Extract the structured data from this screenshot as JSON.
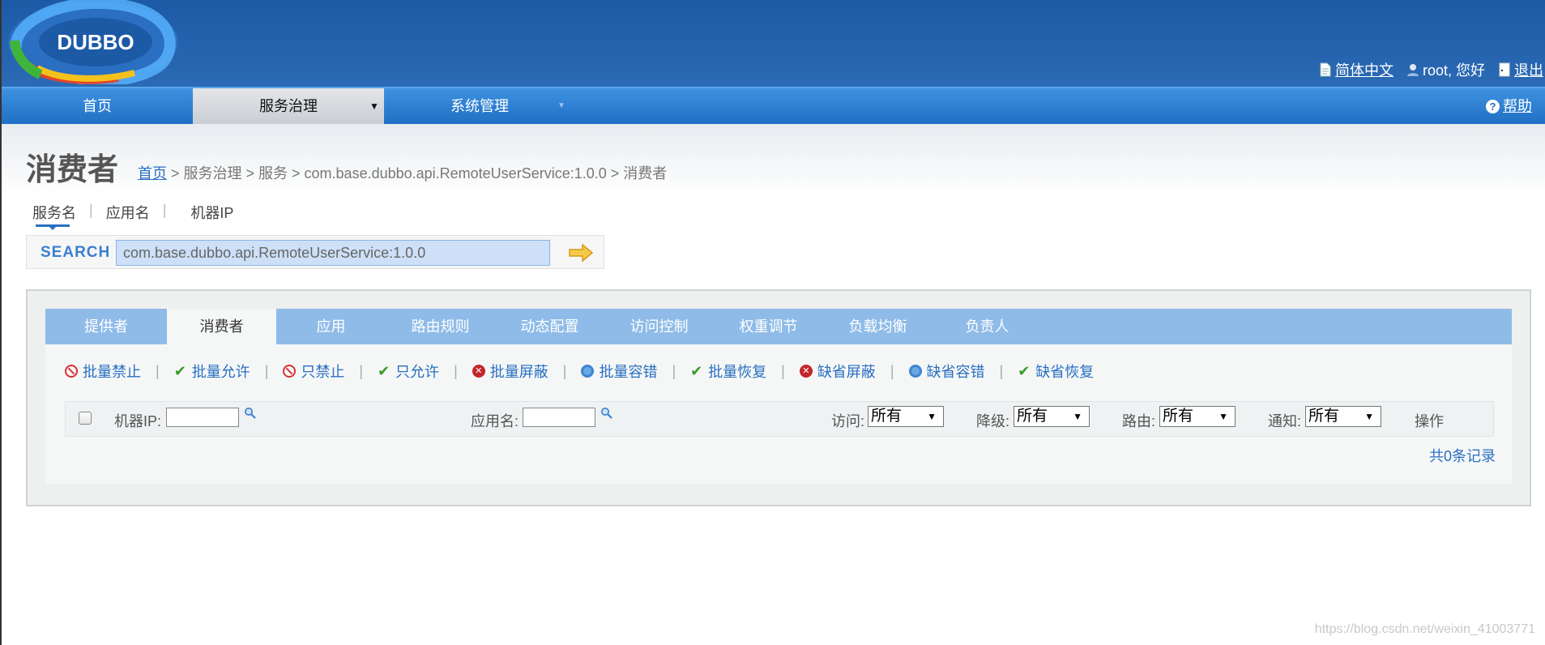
{
  "header": {
    "logo_text": "DUBBO",
    "language_link": "简体中文",
    "user_greeting": "root, 您好",
    "logout_link": "退出"
  },
  "nav": {
    "items": [
      {
        "label": "首页",
        "icon": ""
      },
      {
        "label": "服务治理",
        "icon": "dropdown-arrow"
      },
      {
        "label": "系统管理",
        "icon": "dropdown-arrow"
      }
    ],
    "active": "服务治理",
    "help_label": "帮助"
  },
  "page": {
    "title": "消费者",
    "breadcrumb": {
      "home": "首页",
      "rest": " > 服务治理 > 服务 > com.base.dubbo.api.RemoteUserService:1.0.0 > 消费者"
    }
  },
  "search": {
    "tabs": [
      "服务名",
      "应用名",
      "机器IP"
    ],
    "active_tab": "服务名",
    "label": "SEARCH",
    "value": "com.base.dubbo.api.RemoteUserService:1.0.0"
  },
  "panel": {
    "tabs": [
      "提供者",
      "消费者",
      "应用",
      "路由规则",
      "动态配置",
      "访问控制",
      "权重调节",
      "负载均衡",
      "负责人"
    ],
    "active_tab": "消费者",
    "actions": [
      {
        "label": "批量禁止",
        "icon": "ban-icon"
      },
      {
        "label": "批量允许",
        "icon": "check-icon"
      },
      {
        "label": "只禁止",
        "icon": "ban-icon"
      },
      {
        "label": "只允许",
        "icon": "check-icon"
      },
      {
        "label": "批量屏蔽",
        "icon": "x-circle-icon"
      },
      {
        "label": "批量容错",
        "icon": "gear-icon"
      },
      {
        "label": "批量恢复",
        "icon": "check-icon"
      },
      {
        "label": "缺省屏蔽",
        "icon": "x-circle-icon"
      },
      {
        "label": "缺省容错",
        "icon": "gear-icon"
      },
      {
        "label": "缺省恢复",
        "icon": "check-icon"
      }
    ],
    "filters": {
      "machine_ip_label": "机器IP:",
      "machine_ip_value": "",
      "app_name_label": "应用名:",
      "app_name_value": "",
      "access_label": "访问:",
      "access_value": "所有",
      "degrade_label": "降级:",
      "degrade_value": "所有",
      "route_label": "路由:",
      "route_value": "所有",
      "notify_label": "通知:",
      "notify_value": "所有",
      "operation_label": "操作"
    },
    "total_records": "共0条记录"
  },
  "watermark": "https://blog.csdn.net/weixin_41003771"
}
